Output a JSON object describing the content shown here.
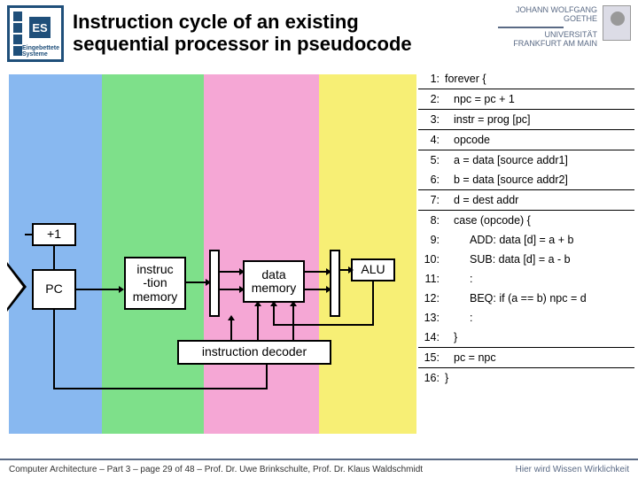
{
  "header": {
    "title_line1": "Instruction cycle of an existing",
    "title_line2": "sequential processor in pseudocode",
    "es_label": "Eingebettete Systeme",
    "uni_name1": "JOHANN WOLFGANG",
    "uni_name2": "GOETHE",
    "uni_name3": "UNIVERSITÄT",
    "uni_name4": "FRANKFURT AM MAIN"
  },
  "boxes": {
    "plus1": "+1",
    "pc": "PC",
    "imem1": "instruc",
    "imem2": "-tion",
    "imem3": "memory",
    "dmem1": "data",
    "dmem2": "memory",
    "alu": "ALU",
    "decoder": "instruction decoder"
  },
  "code": {
    "l1": {
      "n": "1:",
      "t": "forever {"
    },
    "l2": {
      "n": "2:",
      "t": "npc = pc + 1"
    },
    "l3": {
      "n": "3:",
      "t": "instr = prog [pc]"
    },
    "l4": {
      "n": "4:",
      "t": "opcode"
    },
    "l5": {
      "n": "5:",
      "t": "a = data [source addr1]"
    },
    "l6": {
      "n": "6:",
      "t": "b = data [source addr2]"
    },
    "l7": {
      "n": "7:",
      "t": "d = dest addr"
    },
    "l8": {
      "n": "8:",
      "t": "case (opcode) {"
    },
    "l9": {
      "n": "9:",
      "t": "ADD: data [d] = a + b"
    },
    "l10": {
      "n": "10:",
      "t": "SUB: data [d] = a - b"
    },
    "l11": {
      "n": "11:",
      "t": ":"
    },
    "l12": {
      "n": "12:",
      "t": "BEQ: if (a == b) npc = d"
    },
    "l13": {
      "n": "13:",
      "t": ":"
    },
    "l14": {
      "n": "14:",
      "t": "}"
    },
    "l15": {
      "n": "15:",
      "t": "pc = npc"
    },
    "l16": {
      "n": "16:",
      "t": "}"
    }
  },
  "footer": {
    "left": "Computer Architecture – Part 3 – page 29 of 48 – Prof. Dr. Uwe Brinkschulte, Prof. Dr. Klaus Waldschmidt",
    "right": "Hier wird Wissen Wirklichkeit"
  }
}
